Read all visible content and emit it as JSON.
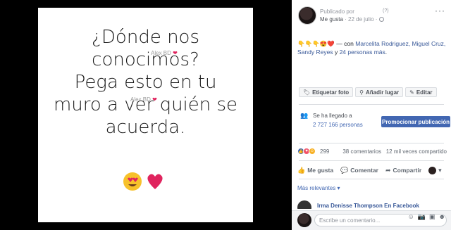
{
  "photo": {
    "lines": [
      "¿Dónde nos",
      "conocimos?",
      "Pega esto en tu",
      "muro a ver quién se",
      "acuerda."
    ],
    "watermark": "Alex BD"
  },
  "post": {
    "published_by_label": "Publicado por",
    "question_mark": "(?)",
    "author_line": "Me gusta",
    "date": "22 de julio",
    "separator": "·",
    "reactions_with_prefix": "— con",
    "tagged_names": "Marcelita Rodriguez, Miguel Cruz, Sandy Reyes",
    "and_text": "y",
    "others": "24 personas más",
    "period": "."
  },
  "tag_buttons": {
    "tag_photo": "Etiquetar foto",
    "add_location": "Añadir lugar",
    "edit": "Editar"
  },
  "reach": {
    "line1": "Se ha llegado a",
    "count": "2 727 166 personas",
    "line3": "personas",
    "promote": "Promocionar publicación"
  },
  "counts": {
    "reactions": "299",
    "comments": "38 comentarios",
    "views": "12 mil veces compartido"
  },
  "actions": {
    "like": "Me gusta",
    "comment": "Comentar",
    "share": "Compartir"
  },
  "comments": {
    "sort_label": "Más relevantes",
    "peek_text": "Irma Denisse Thompson En Facebook",
    "placeholder": "Escribe un comentario..."
  },
  "colors": {
    "accent_blue": "#4267b2",
    "link_blue": "#385898",
    "heart_red": "#e0245e"
  }
}
